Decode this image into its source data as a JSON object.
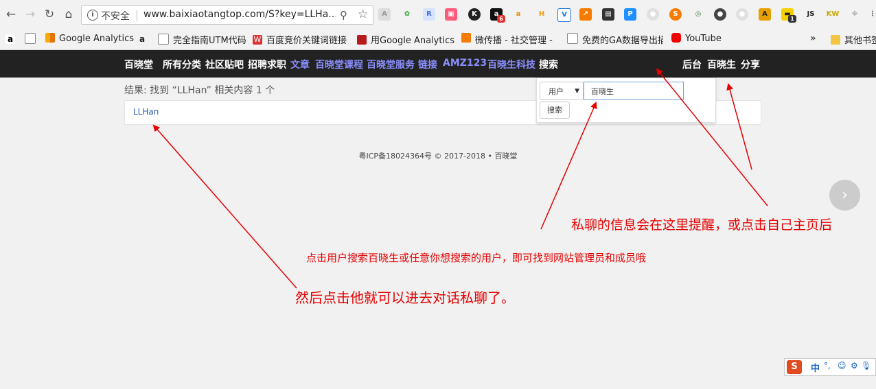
{
  "browser": {
    "insecure_label": "不安全",
    "url": "www.baixiaotangtop.com/S?key=LLHa...",
    "ext_badge_a": "6",
    "ext_badge_b": "1",
    "ext_js": "JS",
    "ext_kw": "KW"
  },
  "bookmarks": {
    "items": [
      "Google Analytics",
      "完全指南UTM代码",
      "百度竞价关键词链接",
      "用Google Analytics",
      "微传播 - 社交管理 - U",
      "免费的GA数据导出插",
      "YouTube"
    ],
    "more": "»",
    "other": "其他书签"
  },
  "nav": {
    "brand": "百晓堂",
    "items": [
      "所有分类",
      "社区贴吧",
      "招聘求职",
      "文章",
      "百晓堂课程",
      "百晓堂服务",
      "链接",
      "AMZ123",
      "百晓生科技",
      "搜索"
    ],
    "right": [
      "后台",
      "百晓生",
      "分享"
    ]
  },
  "results": {
    "count_text": "结果: 找到 “LLHan” 相关内容 1 个",
    "items": [
      "LLHan"
    ]
  },
  "footer": "粤ICP备18024364号 © 2017-2018 • 百晓堂",
  "search_popup": {
    "type": "用户",
    "query": "百晓生",
    "button": "搜索"
  },
  "annotations": {
    "note1": "私聊的信息会在这里提醒，或点击自己主页后",
    "note2": "点击用户搜索百晓生或任意你想搜索的用户，即可找到网站管理员和成员哦",
    "note3": "然后点击他就可以进去对话私聊了。"
  },
  "ime": {
    "lang": "中"
  },
  "colors": {
    "nav_bg": "#222222",
    "accent_link": "#8a8ffd",
    "annotation": "#e60000"
  }
}
